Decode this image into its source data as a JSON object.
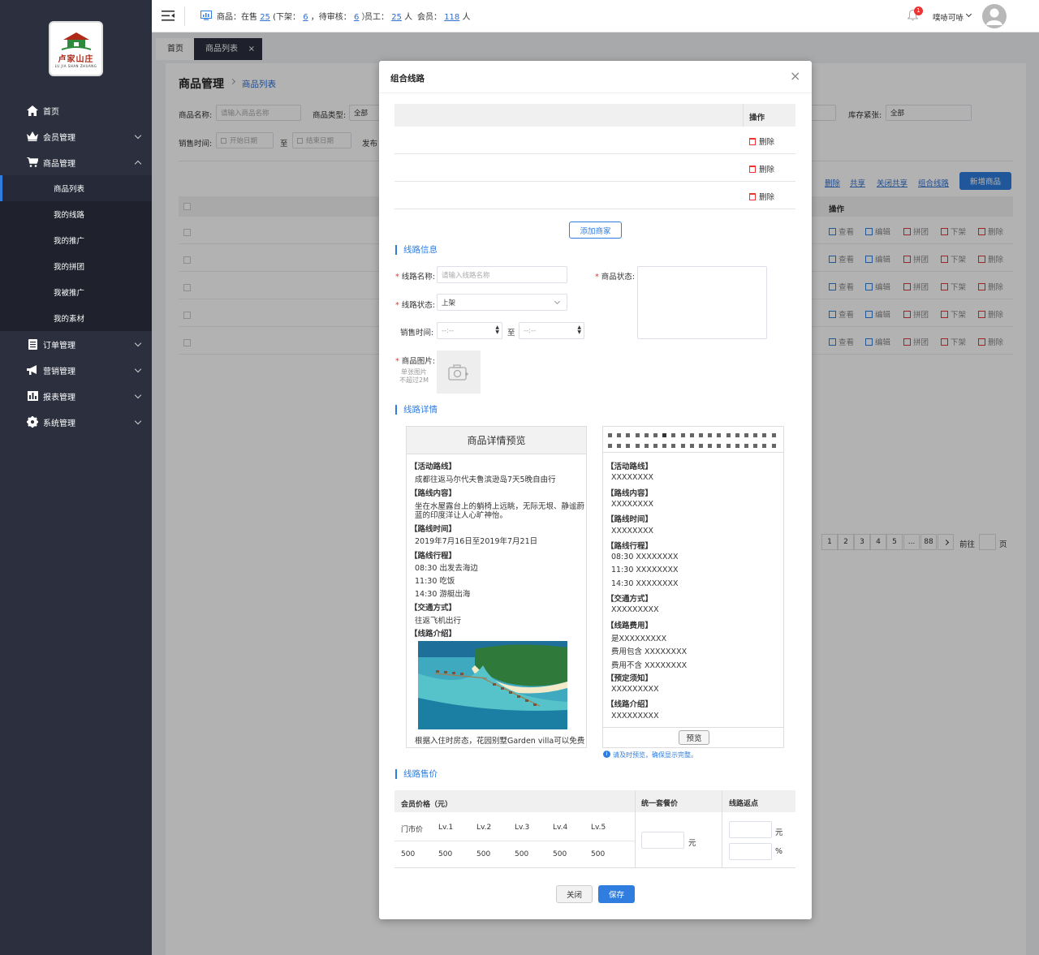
{
  "logo": {
    "title": "卢家山庄",
    "subtitle": "LU JIA SHAN ZHUANG"
  },
  "sidebar": {
    "items": [
      {
        "label": "首页",
        "icon": "home-icon"
      },
      {
        "label": "会员管理",
        "icon": "crown-icon"
      },
      {
        "label": "商品管理",
        "icon": "cart-icon"
      }
    ],
    "sub": [
      "商品列表",
      "我的线路",
      "我的推广",
      "我的拼团",
      "我被推广",
      "我的素材"
    ],
    "items2": [
      {
        "label": "订单管理",
        "icon": "order-icon"
      },
      {
        "label": "营销管理",
        "icon": "megaphone-icon"
      },
      {
        "label": "报表管理",
        "icon": "chart-icon"
      },
      {
        "label": "系统管理",
        "icon": "gear-icon"
      }
    ]
  },
  "topbar": {
    "goods_label": "商品：在售",
    "on_sale": "25",
    "off_label": "(下架：",
    "off": "6",
    "review_label": "，待审核：",
    "review": "6",
    "close_paren": "）",
    "staff_label": "员工：",
    "staff": "25",
    "staff_unit": "人",
    "member_label": "会员：",
    "members": "118",
    "member_unit": "人",
    "notif_count": "1",
    "username": "噗哧可哧"
  },
  "tabs": {
    "home": "首页",
    "list": "商品列表"
  },
  "page": {
    "title": "商品管理",
    "crumb": "商品列表",
    "name_label": "商品名称:",
    "name_ph": "请输入商品名称",
    "type_label": "商品类型:",
    "type_val": "全部",
    "stock_label": "库存紧张:",
    "stock_val": "全部",
    "time_label": "销售时间:",
    "start_ph": "开始日期",
    "to": "至",
    "end_ph": "结束日期",
    "publish_label": "发布",
    "links": [
      "删除",
      "共享",
      "关闭共享",
      "组合线路"
    ],
    "new_btn": "新增商品",
    "ops_header": "操作",
    "row_actions": [
      "查看",
      "编辑",
      "拼团",
      "下架",
      "删除"
    ],
    "pages": [
      "1",
      "2",
      "3",
      "4",
      "5",
      "...",
      "88"
    ],
    "goto": "前往",
    "page_unit": "页"
  },
  "modal": {
    "title": "组合线路",
    "op_header": "操作",
    "delete": "删除",
    "add_merchant": "添加商家",
    "sec1": "线路信息",
    "route_name_label": "线路名称:",
    "route_name_ph": "请输入线路名称",
    "status_label": "商品状态:",
    "route_status_label": "线路状态:",
    "route_status_val": "上架",
    "sale_time_label": "销售时间:",
    "time_ph": "--:--",
    "to": "至",
    "image_label": "商品图片:",
    "image_hint1": "单张图片",
    "image_hint2": "不超过2M",
    "sec2": "线路详情",
    "preview_title": "商品详情预览",
    "preview_lines": [
      "【活动路线】",
      "成都往返马尔代夫鲁滨逊岛7天5晚自由行",
      "【路线内容】",
      "坐在水屋露台上的躺椅上远眺，无际无垠、静谧蔚",
      "蓝的印度洋让人心旷神怡。",
      "【路线时间】",
      "2019年7月16日至2019年7月21日",
      "【路线行程】",
      "08:30  出发去海边",
      "11:30  吃饭",
      "14:30  游艇出海",
      "【交通方式】",
      "往返飞机出行",
      "【线路介绍】"
    ],
    "preview_footer": "根据入住时房态，花园别墅Garden villa可以免费",
    "editor_lines": [
      "【活动路线】",
      "XXXXXXXX",
      "【路线内容】",
      "XXXXXXXX",
      "【路线时间】",
      "XXXXXXXX",
      "【路线行程】",
      "08:30  XXXXXXXX",
      "11:30  XXXXXXXX",
      "14:30  XXXXXXXX",
      "【交通方式】",
      "XXXXXXXXX",
      "【线路费用】",
      "是XXXXXXXXX",
      "费用包含 XXXXXXXX",
      "费用不含 XXXXXXXX",
      "【预定须知】",
      "XXXXXXXXX",
      "【线路介绍】",
      "XXXXXXXXX"
    ],
    "preview_btn": "预览",
    "hint": "请及时预览，确保显示完整。",
    "sec3": "线路售价",
    "price_header": "会员价格（元）",
    "unified_header": "统一套餐价",
    "rebate_header": "线路返点",
    "levels": [
      "门市价",
      "Lv.1",
      "Lv.2",
      "Lv.3",
      "Lv.4",
      "Lv.5"
    ],
    "prices": [
      "500",
      "500",
      "500",
      "500",
      "500",
      "500"
    ],
    "yuan": "元",
    "percent": "%",
    "close_btn": "关闭",
    "save_btn": "保存"
  }
}
